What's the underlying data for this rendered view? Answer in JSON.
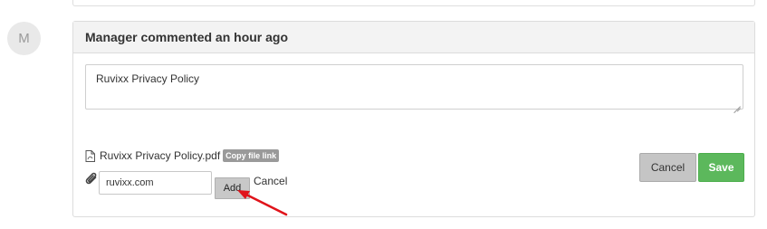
{
  "avatar": {
    "initial": "M"
  },
  "comment": {
    "header": "Manager commented an hour ago",
    "text": "Ruvixx Privacy Policy"
  },
  "attachment": {
    "icon": "pdf-file-icon",
    "filename": "Ruvixx Privacy Policy.pdf",
    "copy_link_label": "Copy file link"
  },
  "link_form": {
    "icon": "paperclip-icon",
    "value": "ruvixx.com",
    "add_label": "Add",
    "cancel_label": "Cancel"
  },
  "actions": {
    "cancel_label": "Cancel",
    "save_label": "Save"
  },
  "colors": {
    "save": "#5cb85c",
    "annotation_arrow": "#e0141b"
  }
}
